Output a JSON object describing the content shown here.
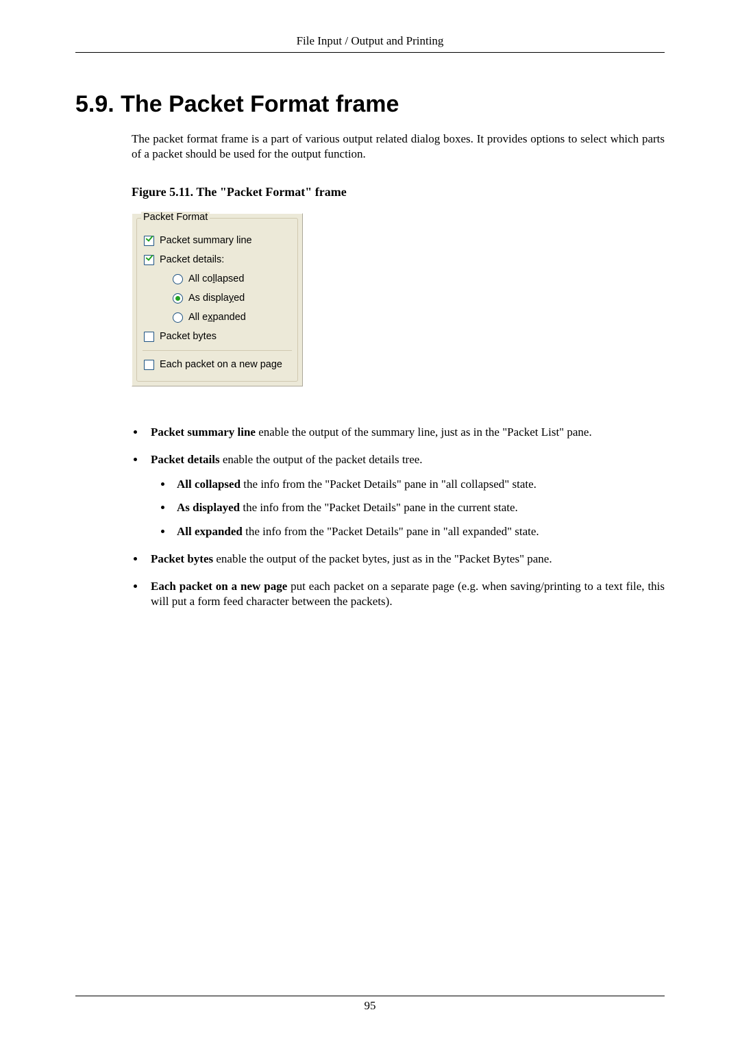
{
  "header": {
    "title": "File Input / Output and Printing"
  },
  "section": {
    "number": "5.9.",
    "title": "The Packet Format frame",
    "intro": "The packet format frame is a part of various output related dialog boxes. It provides options to select which parts of a packet should be used for the output function."
  },
  "figure": {
    "caption": "Figure 5.11. The \"Packet Format\" frame"
  },
  "pf": {
    "legend": "Packet Format",
    "summary": {
      "label": "Packet summary line",
      "checked": true
    },
    "details": {
      "label": "Packet details:",
      "checked": true
    },
    "radios": {
      "collapsed": {
        "pre": "All co",
        "u": "l",
        "post": "lapsed",
        "on": false
      },
      "displayed": {
        "pre": "As displa",
        "u": "y",
        "post": "ed",
        "on": true
      },
      "expanded": {
        "pre": "All e",
        "u": "x",
        "post": "panded",
        "on": false
      }
    },
    "bytes": {
      "label": "Packet bytes",
      "checked": false
    },
    "newpage": {
      "label": "Each packet on a new page",
      "checked": false
    }
  },
  "list": {
    "i1": {
      "b": "Packet summary line",
      "t": " enable the output of the summary line, just as in the \"Packet List\" pane."
    },
    "i2": {
      "b": "Packet details",
      "t": " enable the output of the packet details tree."
    },
    "i2a": {
      "b": "All collapsed",
      "t": " the info from the \"Packet Details\" pane in \"all collapsed\" state."
    },
    "i2b": {
      "b": "As displayed",
      "t": " the info from the \"Packet Details\" pane in the current state."
    },
    "i2c": {
      "b": "All expanded",
      "t": " the info from the \"Packet Details\" pane in \"all expanded\" state."
    },
    "i3": {
      "b": "Packet bytes",
      "t": " enable the output of the packet bytes, just as in the \"Packet Bytes\" pane."
    },
    "i4": {
      "b": "Each packet on a new page",
      "t": " put each packet on a separate page (e.g. when saving/printing to a text file, this will put a form feed character between the packets)."
    }
  },
  "footer": {
    "page": "95"
  }
}
